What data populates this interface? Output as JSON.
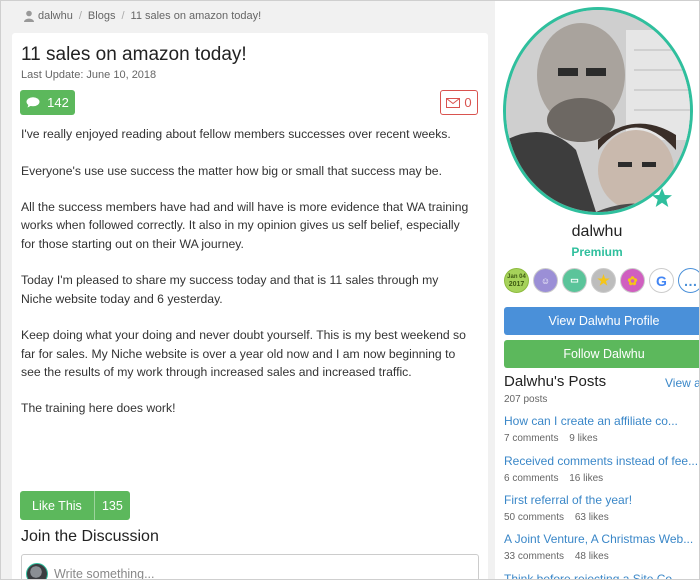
{
  "breadcrumb": {
    "user": "dalwhu",
    "section": "Blogs",
    "current": "11 sales on amazon today!",
    "separator": "/"
  },
  "post": {
    "title": "11 sales on amazon today!",
    "date": "Last Update: June 10, 2018",
    "comment_count": "142",
    "mail_count": "0",
    "paragraphs": [
      "I've really enjoyed reading about fellow members successes over recent weeks.",
      "Everyone's use use success the matter how big or small that success may be.",
      "All the success members have had and will have is more evidence that WA training works when followed correctly. It also in my opinion gives us self belief, especially for those starting out on their WA journey.",
      "Today I'm pleased to share my success today and that is 11 sales through my Niche website today and 6 yesterday.",
      "Keep doing what your doing and never doubt yourself. This is my best weekend so far for sales. My Niche website is over a year old now and I am now beginning to see the results of my work through increased sales and increased traffic.",
      "The training here does work!"
    ],
    "like_label": "Like This",
    "like_count": "135"
  },
  "discussion": {
    "heading": "Join the Discussion",
    "placeholder": "Write something..."
  },
  "sidebar": {
    "username": "dalwhu",
    "membership": "Premium",
    "badges": [
      {
        "name": "jan-04-2017-badge",
        "line1": "Jan 04",
        "line2": "2017",
        "color": "#a6d25a"
      },
      {
        "name": "user-badge-icon",
        "glyph": "☺",
        "color": "#9b8fd6"
      },
      {
        "name": "screen-badge-icon",
        "glyph": "▭",
        "color": "#5bc49a"
      },
      {
        "name": "star-badge-icon",
        "glyph": "★",
        "color": "#bdbdbd"
      },
      {
        "name": "medal-badge-icon",
        "glyph": "✿",
        "color": "#d05fc0"
      },
      {
        "name": "google-badge-icon",
        "glyph": "G",
        "color": "#ffffff"
      },
      {
        "name": "more-badge-icon",
        "glyph": "…",
        "color": "#ffffff"
      }
    ],
    "profile_button": "View Dalwhu Profile",
    "follow_button": "Follow Dalwhu",
    "posts_heading": "Dalwhu's Posts",
    "view_all": "View a",
    "posts_count": "207 posts",
    "posts": [
      {
        "title": "How can I create an affiliate co...",
        "comments": "7 comments",
        "likes": "9 likes"
      },
      {
        "title": "Received comments instead of fee...",
        "comments": "6 comments",
        "likes": "16 likes"
      },
      {
        "title": "First referral of the year!",
        "comments": "50 comments",
        "likes": "63 likes"
      },
      {
        "title": "A Joint Venture, A Christmas Web...",
        "comments": "33 comments",
        "likes": "48 likes"
      },
      {
        "title": "Think before rejecting a Site Co...",
        "comments": "",
        "likes": ""
      }
    ]
  },
  "colors": {
    "green": "#5cb85c",
    "blue": "#4a90d9",
    "teal": "#2fbf9d",
    "link": "#3a87c8",
    "red": "#d9534f"
  }
}
